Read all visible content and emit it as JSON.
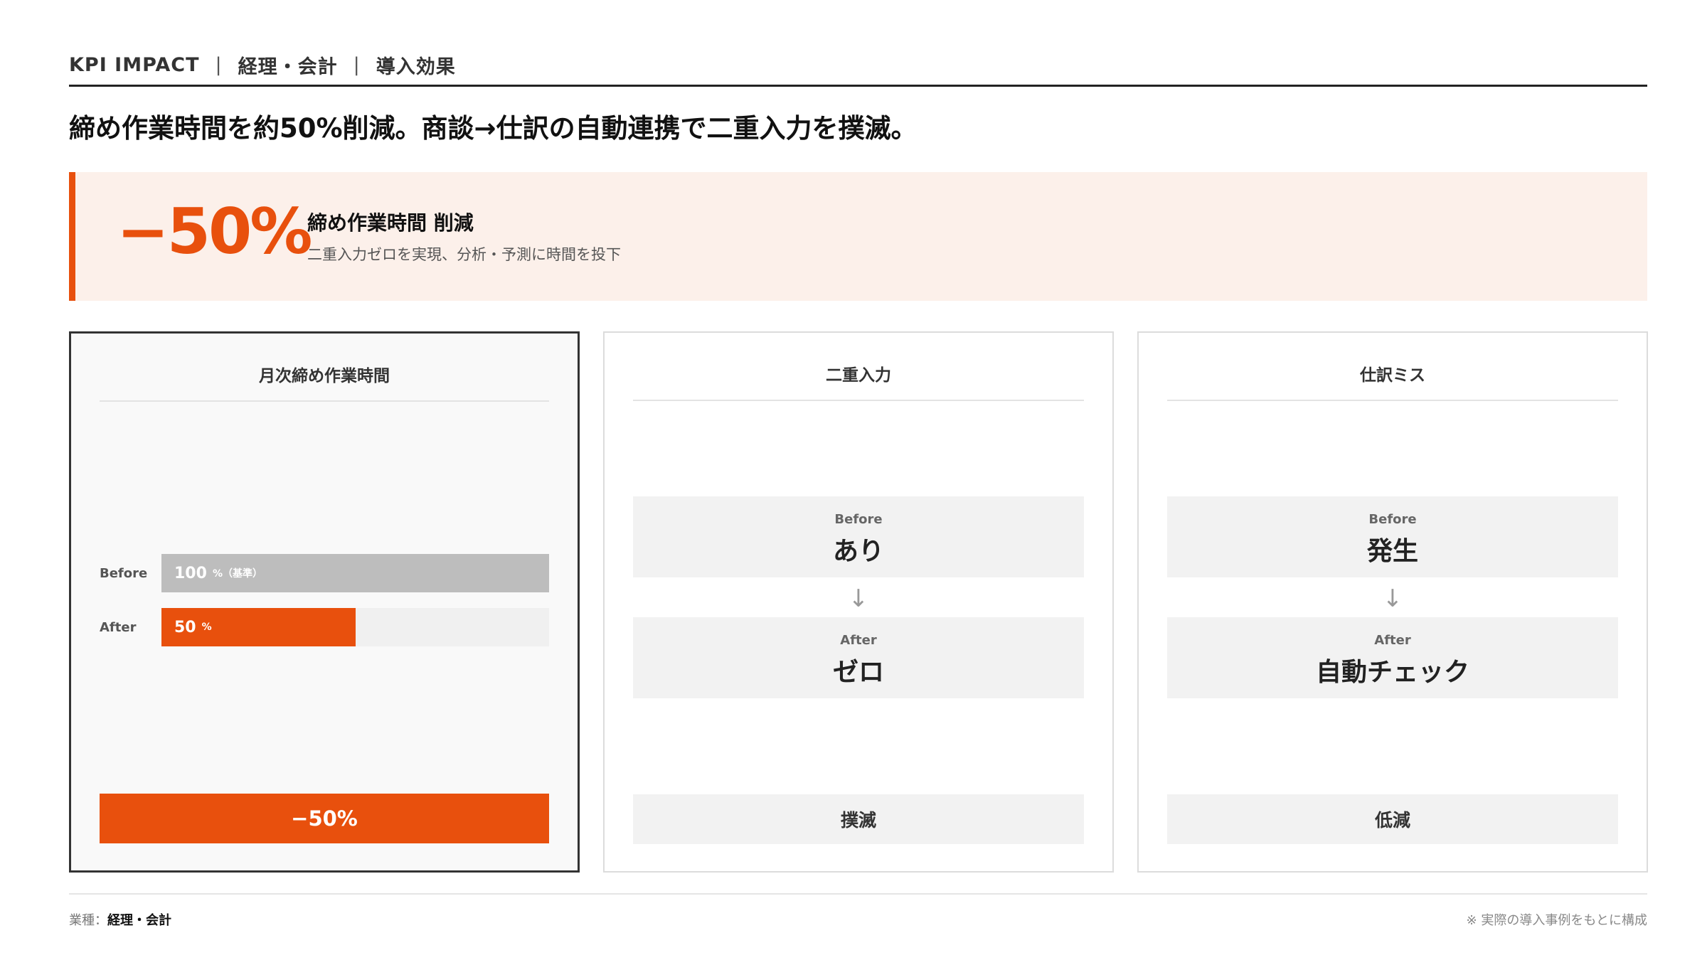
{
  "header": {
    "kpi_label": "KPI IMPACT",
    "separator": "|",
    "category": "経理・会計",
    "section": "導入効果"
  },
  "headline": "締め作業時間を約50%削減。商談→仕訳の自動連携で二重入力を撲滅。",
  "summary": {
    "big_number": "−50%",
    "title": "締め作業時間 削減",
    "subtitle": "二重入力ゼロを実現、分析・予測に時間を投下"
  },
  "cards": {
    "closing_time": {
      "title": "月次締め作業時間",
      "before_label": "Before",
      "before_value": "100",
      "before_unit": "%（基準）",
      "before_fraction": 1.0,
      "after_label": "After",
      "after_value": "50",
      "after_unit": "%",
      "after_fraction": 0.5,
      "result": "−50%"
    },
    "double_entry": {
      "title": "二重入力",
      "before_tag": "Before",
      "before_value": "あり",
      "arrow": "↓",
      "after_tag": "After",
      "after_value": "ゼロ",
      "result": "撲滅"
    },
    "journal_errors": {
      "title": "仕訳ミス",
      "before_tag": "Before",
      "before_value": "発生",
      "arrow": "↓",
      "after_tag": "After",
      "after_value": "自動チェック",
      "result": "低減"
    }
  },
  "footer": {
    "industry_label": "業種：",
    "industry_value": "経理・会計",
    "note": "※ 実際の導入事例をもとに構成"
  },
  "colors": {
    "accent": "#e8500d",
    "accent_light": "#fcf0ea",
    "neutral_bar": "#bdbdbd",
    "box_bg": "#f2f2f2"
  }
}
